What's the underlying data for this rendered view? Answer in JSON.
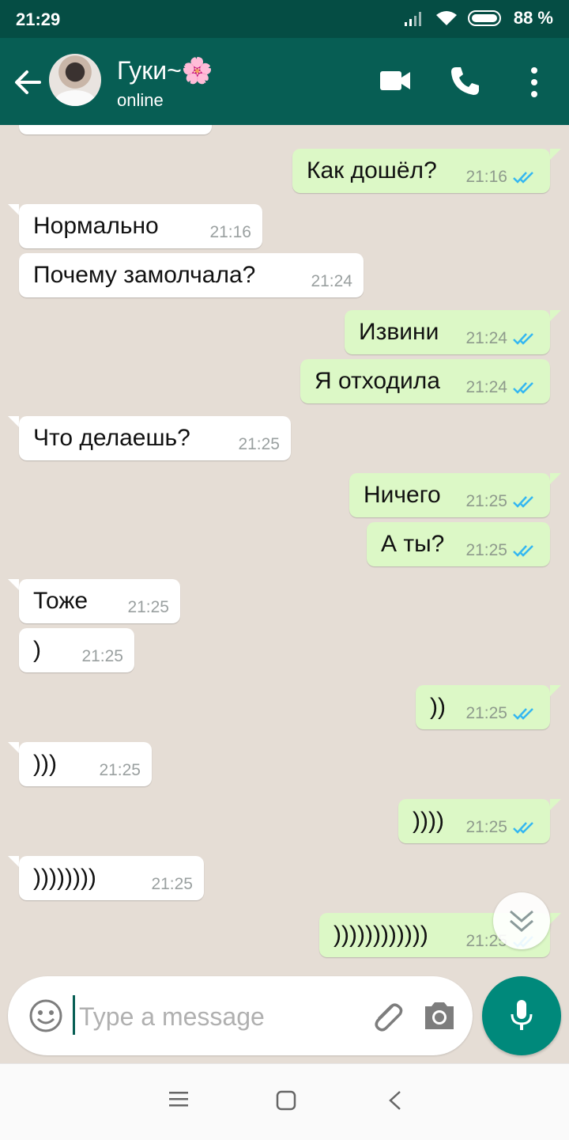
{
  "status_bar": {
    "time": "21:29",
    "battery": "88 %"
  },
  "header": {
    "contact_name": "Гуки~🌸",
    "status": "online"
  },
  "messages": [
    {
      "text": "",
      "time": "",
      "dir": "in"
    },
    {
      "text": "Как дошёл?",
      "time": "21:16",
      "dir": "out"
    },
    {
      "text": "Нормально",
      "time": "21:16",
      "dir": "in"
    },
    {
      "text": "Почему замолчала?",
      "time": "21:24",
      "dir": "in"
    },
    {
      "text": "Извини",
      "time": "21:24",
      "dir": "out"
    },
    {
      "text": "Я отходила",
      "time": "21:24",
      "dir": "out"
    },
    {
      "text": "Что делаешь?",
      "time": "21:25",
      "dir": "in"
    },
    {
      "text": "Ничего",
      "time": "21:25",
      "dir": "out"
    },
    {
      "text": "А ты?",
      "time": "21:25",
      "dir": "out"
    },
    {
      "text": "Тоже",
      "time": "21:25",
      "dir": "in"
    },
    {
      "text": ")",
      "time": "21:25",
      "dir": "in"
    },
    {
      "text": "))",
      "time": "21:25",
      "dir": "out"
    },
    {
      "text": ")))",
      "time": "21:25",
      "dir": "in"
    },
    {
      "text": "))))",
      "time": "21:25",
      "dir": "out"
    },
    {
      "text": "))))))))",
      "time": "21:25",
      "dir": "in"
    },
    {
      "text": "))))))))))))",
      "time": "21:25",
      "dir": "out"
    }
  ],
  "composer": {
    "placeholder": "Type a message"
  },
  "colors": {
    "header": "#075e54",
    "status_bar": "#054d44",
    "outgoing": "#dcf8c6",
    "incoming": "#ffffff",
    "ticks": "#34b7f1",
    "mic": "#00897b"
  },
  "icons": [
    "back-arrow-icon",
    "video-call-icon",
    "phone-icon",
    "more-vert-icon",
    "emoji-icon",
    "paperclip-icon",
    "camera-icon",
    "mic-icon",
    "chevron-double-down-icon"
  ]
}
